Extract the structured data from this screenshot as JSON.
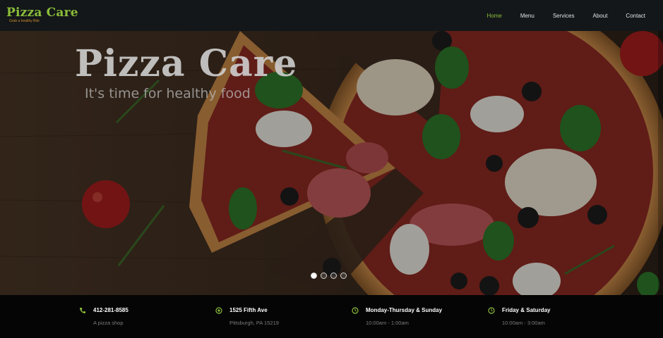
{
  "brand": {
    "name": "Pizza Care",
    "tagline": "Grab a healthy Bite"
  },
  "nav": {
    "items": [
      "Home",
      "Menu",
      "Services",
      "About",
      "Contact"
    ],
    "active": "Home"
  },
  "hero": {
    "title": "Pizza Care",
    "subtitle": "It's time for healthy food",
    "slides": 4,
    "active_slide": 1
  },
  "info": [
    {
      "icon": "phone-icon",
      "title": "412-281-8585",
      "sub": "A pizza shop"
    },
    {
      "icon": "location-icon",
      "title": "1525 Fifth Ave",
      "sub": "Pittsburgh, PA 15219"
    },
    {
      "icon": "clock-icon",
      "title": "Monday-Thursday & Sunday",
      "sub": "10:00am - 1:00am"
    },
    {
      "icon": "clock-icon",
      "title": "Friday & Saturday",
      "sub": "10:00am - 3:00am"
    }
  ],
  "colors": {
    "accent": "#8cbd3a",
    "logo_tagline": "#c98a2a",
    "nav_bg": "#131719",
    "info_bg": "#050505"
  }
}
